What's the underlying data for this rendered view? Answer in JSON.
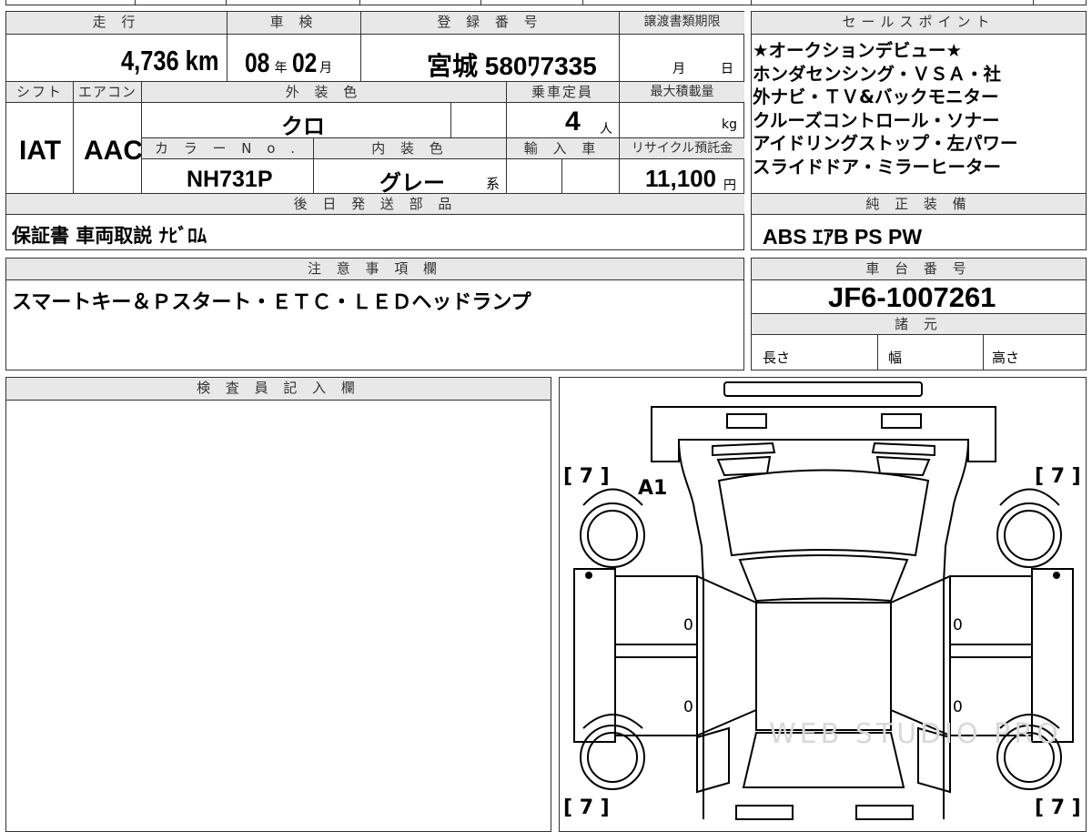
{
  "top": {
    "mileage_label": "走 行",
    "mileage_value": "4,736",
    "mileage_unit": "km",
    "inspection_label": "車 検",
    "inspection_year": "08",
    "inspection_year_unit": "年",
    "inspection_month": "02",
    "inspection_month_unit": "月",
    "registration_label": "登 録 番 号",
    "registration_value": "宮城 580ﾜ7335",
    "transfer_deadline_label": "譲渡書類期限",
    "transfer_month_unit": "月",
    "transfer_day_unit": "日"
  },
  "spec": {
    "shift_label": "シフト",
    "shift_value": "IAT",
    "ac_label": "エアコン",
    "ac_value": "AAC",
    "exterior_color_label": "外 装 色",
    "exterior_color_value": "クロ",
    "capacity_label": "乗車定員",
    "capacity_value": "4",
    "capacity_unit": "人",
    "max_load_label": "最大積載量",
    "max_load_unit": "kg",
    "color_no_label": "カ ラ ー N o .",
    "color_no_value": "NH731P",
    "interior_color_label": "内 装 色",
    "interior_color_value": "グレー",
    "interior_color_suffix": "系",
    "import_label": "輸 入 車",
    "recycle_label": "リサイクル預託金",
    "recycle_value": "11,100",
    "recycle_unit": "円"
  },
  "later_parts": {
    "label": "後 日 発 送 部 品",
    "value": "保証書 車両取説 ﾅﾋﾞﾛﾑ"
  },
  "sales_points": {
    "label": "セールスポイント",
    "lines": [
      "★オークションデビュー★",
      "ホンダセンシング・ＶＳＡ・社",
      "外ナビ・ＴＶ&バックモニター",
      "クルーズコントロール・ソナー",
      "アイドリングストップ・左パワー",
      "スライドドア・ミラーヒーター"
    ]
  },
  "genuine_equipment": {
    "label": "純 正 装 備",
    "value": "ABS ｴｱB PS PW"
  },
  "notes": {
    "label": "注 意 事 項 欄",
    "value": "スマートキー＆Ｐスタート・ＥＴＣ・ＬＥＤヘッドランプ"
  },
  "chassis": {
    "label": "車 台 番 号",
    "value": "JF6-1007261"
  },
  "dimensions": {
    "label": "諸 元",
    "length_label": "長さ",
    "width_label": "幅",
    "height_label": "高さ"
  },
  "inspector": {
    "label": "検 査 員 記 入 欄"
  },
  "diagram": {
    "tire_fl": "[ 7 ]",
    "tire_fr": "[ 7 ]",
    "tire_rl": "[ 7 ]",
    "tire_rr": "[ 7 ]",
    "damage_mark": "A1",
    "door_fl": "0",
    "door_rl": "0",
    "door_fr": "0",
    "door_rr": "0",
    "watermark": "WEB STUDIO PRO"
  }
}
